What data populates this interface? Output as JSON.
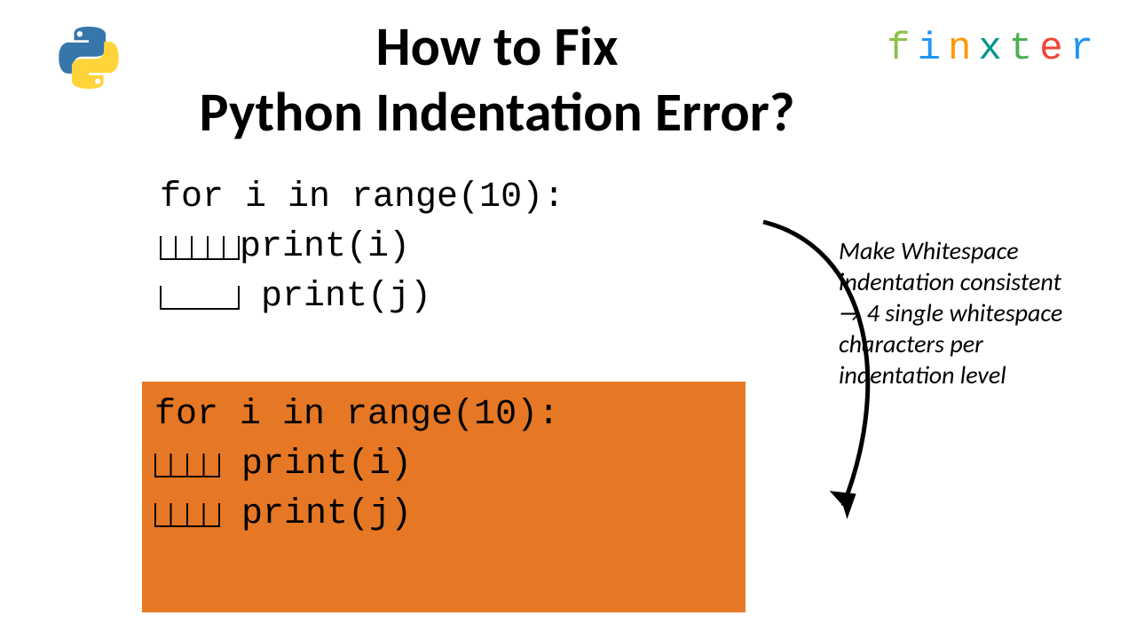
{
  "title": "How to Fix\nPython Indentation Error?",
  "brand": {
    "letters": [
      "f",
      "i",
      "n",
      "x",
      "t",
      "e",
      "r"
    ],
    "classes": [
      "fx-f",
      "fx-i",
      "fx-n",
      "fx-x",
      "fx-t",
      "fx-e",
      "fx-r"
    ]
  },
  "code_bad": {
    "line1": "for i in range(10):",
    "indent2_count": 5,
    "line2": "print(i)",
    "indent3_tab": true,
    "line3": "  print(j)"
  },
  "code_good": {
    "line1": "for i in range(10):",
    "indent_count": 4,
    "line2": " print(i)",
    "line3": " print(j)"
  },
  "annotation": "Make Whitespace indentation consistent → 4 single whitespace characters per indentation level"
}
